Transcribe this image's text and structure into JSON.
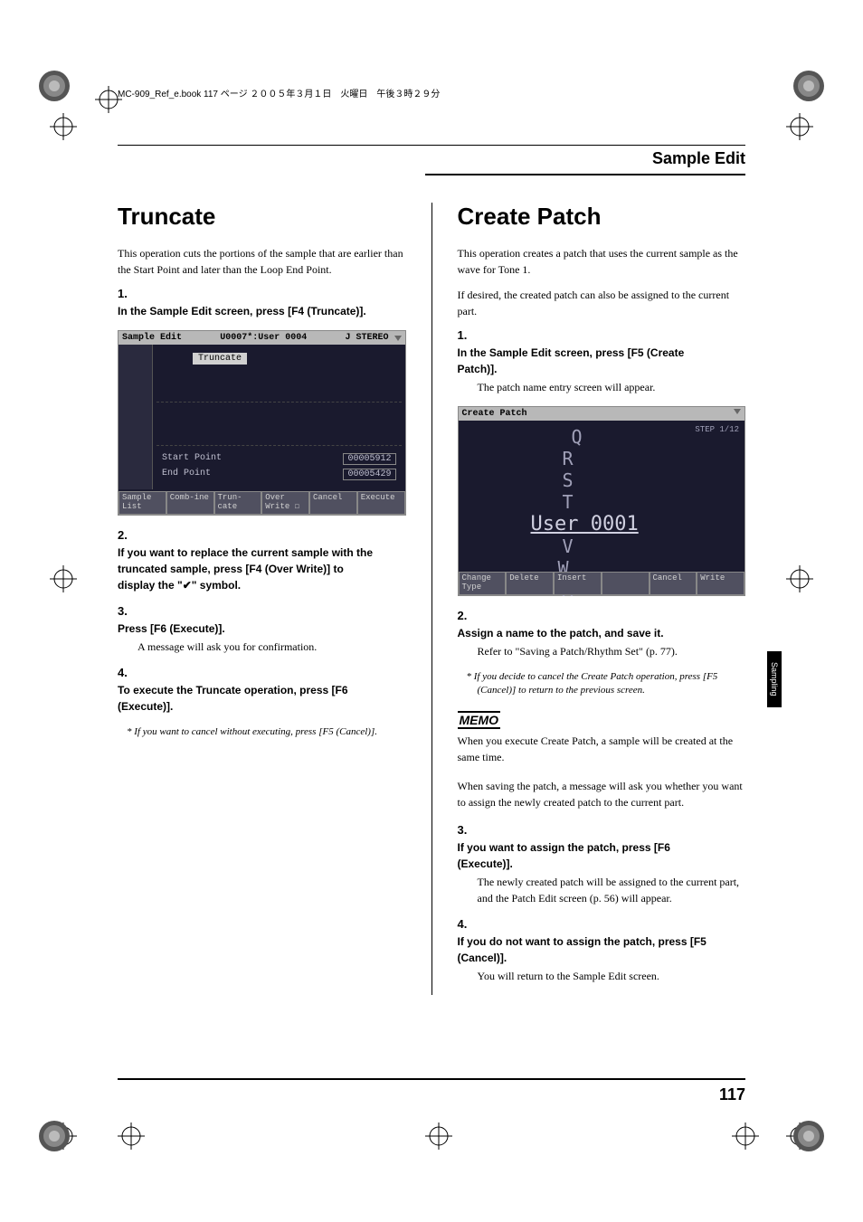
{
  "print_header": "MC-909_Ref_e.book  117 ページ  ２００５年３月１日　火曜日　午後３時２９分",
  "page_header": "Sample Edit",
  "side_tab": "Sampling",
  "page_number": "117",
  "left": {
    "heading": "Truncate",
    "intro": "This operation cuts the portions of the sample that are earlier than the Start Point and later than the Loop End Point.",
    "steps": [
      {
        "n": "1.",
        "bold": "In the Sample Edit screen, press [F4 (Truncate)]."
      },
      {
        "n": "2.",
        "bold": "If you want to replace the current sample with the truncated sample, press [F4 (Over Write)] to display the \"✔\" symbol."
      },
      {
        "n": "3.",
        "bold": "Press [F6 (Execute)].",
        "text": "A message will ask you for confirmation."
      },
      {
        "n": "4.",
        "bold": "To execute the Truncate operation, press [F6 (Execute)]."
      }
    ],
    "note": "If you want to cancel without executing, press [F5 (Cancel)].",
    "lcd": {
      "title_l": "Sample Edit",
      "title_m": "U0007*:User 0004",
      "title_r1": "J",
      "title_r2": "STEREO",
      "tab": "Truncate",
      "start_label": "Start Point",
      "start_val": "00005912",
      "end_label": "End Point",
      "end_val": "00005429",
      "buttons": [
        "Sample List",
        "Comb-ine",
        "Trun-cate",
        "Over Write ☐",
        "Cancel",
        "Execute"
      ]
    }
  },
  "right": {
    "heading": "Create Patch",
    "intro1": "This operation creates a patch that uses the current sample as the wave for Tone 1.",
    "intro2": "If desired, the created patch can also be assigned to the current part.",
    "steps1": [
      {
        "n": "1.",
        "bold": "In the Sample Edit screen, press [F5 (Create Patch)].",
        "text": "The patch name entry screen will appear."
      }
    ],
    "lcd": {
      "title": "Create Patch",
      "step": "STEP 1/12",
      "chars_top": "Q R S T",
      "main": "User 0001",
      "chars_bot": "V W X Y",
      "buttons": [
        "Change Type",
        "Delete",
        "Insert",
        "",
        "Cancel",
        "Write"
      ]
    },
    "steps2": [
      {
        "n": "2.",
        "bold": "Assign a name to the patch, and save it.",
        "text": "Refer to \"Saving a Patch/Rhythm Set\" (p. 77)."
      }
    ],
    "note1": "If you decide to cancel the Create Patch operation, press [F5 (Cancel)] to return to the previous screen.",
    "memo_label": "MEMO",
    "memo1": "When you execute Create Patch, a sample will be created at the same time.",
    "memo2": "When saving the patch, a message will ask you whether you want to assign the newly created patch to the current part.",
    "steps3": [
      {
        "n": "3.",
        "bold": "If you want to assign the patch, press [F6 (Execute)].",
        "text": "The newly created patch will be assigned to the current part, and the Patch Edit screen (p. 56) will appear."
      },
      {
        "n": "4.",
        "bold": "If you do not want to assign the patch, press [F5 (Cancel)].",
        "text": "You will return to the Sample Edit screen."
      }
    ]
  }
}
